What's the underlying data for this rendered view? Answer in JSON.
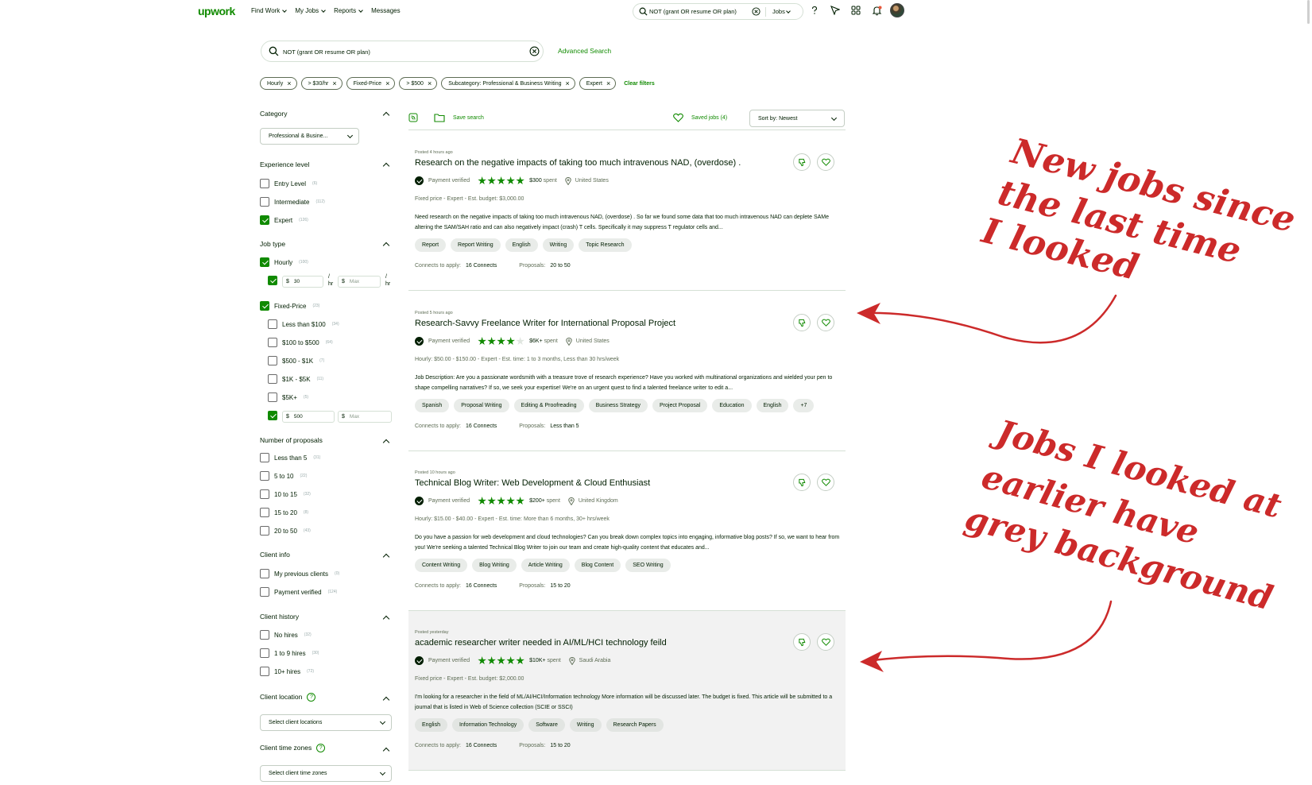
{
  "nav": {
    "logo": "upwork",
    "links": [
      "Find Work",
      "My Jobs",
      "Reports",
      "Messages"
    ],
    "search_query": "NOT (grant OR resume OR plan)",
    "search_scope": "Jobs"
  },
  "search": {
    "query": "NOT (grant OR resume OR plan)",
    "advanced_label": "Advanced Search"
  },
  "filter_chips": [
    "Hourly",
    "> $30/hr",
    "Fixed-Price",
    "> $500",
    "Subcategory: Professional & Business Writing",
    "Expert"
  ],
  "clear_filters": "Clear filters",
  "sidebar": {
    "category": {
      "title": "Category",
      "value": "Professional & Busine..."
    },
    "experience": {
      "title": "Experience level",
      "items": [
        {
          "label": "Entry Level",
          "count": "(6)",
          "checked": false
        },
        {
          "label": "Intermediate",
          "count": "(112)",
          "checked": false
        },
        {
          "label": "Expert",
          "count": "(126)",
          "checked": true
        }
      ]
    },
    "job_type": {
      "title": "Job type",
      "hourly": {
        "label": "Hourly",
        "count": "(100)",
        "checked": true
      },
      "hourly_min": "30",
      "hourly_max_placeholder": "Max",
      "per_hr": "/ hr",
      "fixed": {
        "label": "Fixed-Price",
        "count": "(23)",
        "checked": true
      },
      "fixed_items": [
        {
          "label": "Less than $100",
          "count": "(34)",
          "checked": false
        },
        {
          "label": "$100 to $500",
          "count": "(64)",
          "checked": false
        },
        {
          "label": "$500 - $1K",
          "count": "(7)",
          "checked": false
        },
        {
          "label": "$1K - $5K",
          "count": "(11)",
          "checked": false
        },
        {
          "label": "$5K+",
          "count": "(5)",
          "checked": false
        }
      ],
      "fixed_min": "500",
      "fixed_max_placeholder": "Max",
      "currency": "$"
    },
    "proposals": {
      "title": "Number of proposals",
      "items": [
        {
          "label": "Less than 5",
          "count": "(31)"
        },
        {
          "label": "5 to 10",
          "count": "(22)"
        },
        {
          "label": "10 to 15",
          "count": "(32)"
        },
        {
          "label": "15 to 20",
          "count": "(8)"
        },
        {
          "label": "20 to 50",
          "count": "(43)"
        }
      ]
    },
    "client_info": {
      "title": "Client info",
      "items": [
        {
          "label": "My previous clients",
          "count": "(0)"
        },
        {
          "label": "Payment verified",
          "count": "(124)"
        }
      ]
    },
    "client_history": {
      "title": "Client history",
      "items": [
        {
          "label": "No hires",
          "count": "(32)"
        },
        {
          "label": "1 to 9 hires",
          "count": "(30)"
        },
        {
          "label": "10+ hires",
          "count": "(72)"
        }
      ]
    },
    "client_location": {
      "title": "Client location",
      "placeholder": "Select client locations"
    },
    "client_time_zones": {
      "title": "Client time zones",
      "placeholder": "Select client time zones"
    }
  },
  "toolbar": {
    "save_search": "Save search",
    "saved_jobs": "Saved jobs (4)",
    "sort": "Sort by: Newest"
  },
  "jobs": [
    {
      "posted": "Posted 4 hours ago",
      "title": "Research on the negative impacts of taking too much intravenous NAD, (overdose) .",
      "payment": "Payment verified",
      "rating": 5,
      "spent_amount": "$300",
      "spent_label": "spent",
      "location": "United States",
      "info": "Fixed price - Expert - Est. budget: $3,000.00",
      "description": "Need research on the negative impacts of taking too much intravenous NAD, (overdose) . So far we found some data that too much intravenous NAD can deplete SAMe altering the SAM/SAH ratio and can also negatively impact (crash) T cells. Specifically it may suppress T regulator cells and...",
      "tags": [
        "Report",
        "Report Writing",
        "English",
        "Writing",
        "Topic Research"
      ],
      "connects_label": "Connects to apply:",
      "connects": "16 Connects",
      "proposals_label": "Proposals:",
      "proposals": "20 to 50",
      "seen": false
    },
    {
      "posted": "Posted 5 hours ago",
      "title": "Research-Savvy Freelance Writer for International Proposal Project",
      "payment": "Payment verified",
      "rating": 4,
      "spent_amount": "$6K+",
      "spent_label": "spent",
      "location": "United States",
      "info": "Hourly: $50.00 - $150.00 - Expert - Est. time: 1 to 3 months, Less than 30 hrs/week",
      "description": "Job Description: Are you a passionate wordsmith with a treasure trove of research experience? Have you worked with multinational organizations and wielded your pen to shape compelling narratives? If so, we seek your expertise! We're on an urgent quest to find a talented freelance writer to edit a...",
      "tags": [
        "Spanish",
        "Proposal Writing",
        "Editing & Proofreading",
        "Business Strategy",
        "Project Proposal",
        "Education",
        "English",
        "+7"
      ],
      "connects_label": "Connects to apply:",
      "connects": "16 Connects",
      "proposals_label": "Proposals:",
      "proposals": "Less than 5",
      "seen": false
    },
    {
      "posted": "Posted 10 hours ago",
      "title": "Technical Blog Writer: Web Development & Cloud Enthusiast",
      "payment": "Payment verified",
      "rating": 5,
      "spent_amount": "$200+",
      "spent_label": "spent",
      "location": "United Kingdom",
      "info": "Hourly: $15.00 - $40.00 - Expert - Est. time: More than 6 months, 30+ hrs/week",
      "description": "Do you have a passion for web development and cloud technologies? Can you break down complex topics into engaging, informative blog posts? If so, we want to hear from you! We're seeking a talented Technical Blog Writer to join our team and create high-quality content that educates and...",
      "tags": [
        "Content Writing",
        "Blog Writing",
        "Article Writing",
        "Blog Content",
        "SEO Writing"
      ],
      "connects_label": "Connects to apply:",
      "connects": "16 Connects",
      "proposals_label": "Proposals:",
      "proposals": "15 to 20",
      "seen": false
    },
    {
      "posted": "Posted yesterday",
      "title": "academic researcher writer needed in AI/ML/HCI technology feild",
      "payment": "Payment verified",
      "rating": 5,
      "spent_amount": "$10K+",
      "spent_label": "spent",
      "location": "Saudi Arabia",
      "info": "Fixed price - Expert - Est. budget: $2,000.00",
      "description": "I'm looking for a researcher in the field of ML/AI/HCI/Information technology More information will be discussed later. The budget is fixed. This article will be submitted to a journal that is listed in Web of Science collection (SCIE or SSCI)",
      "tags": [
        "English",
        "Information Technology",
        "Software",
        "Writing",
        "Research Papers"
      ],
      "connects_label": "Connects to apply:",
      "connects": "16 Connects",
      "proposals_label": "Proposals:",
      "proposals": "15 to 20",
      "seen": true
    }
  ],
  "annotations": {
    "new_jobs": [
      "New jobs since",
      "the last time",
      "I looked"
    ],
    "old_jobs": [
      "Jobs I looked at",
      "earlier have",
      "grey background"
    ],
    "color": "#cc2a2a"
  },
  "colors": {
    "brand": "#108a00",
    "text": "#001e00",
    "seen_bg": "#f2f2f2"
  }
}
